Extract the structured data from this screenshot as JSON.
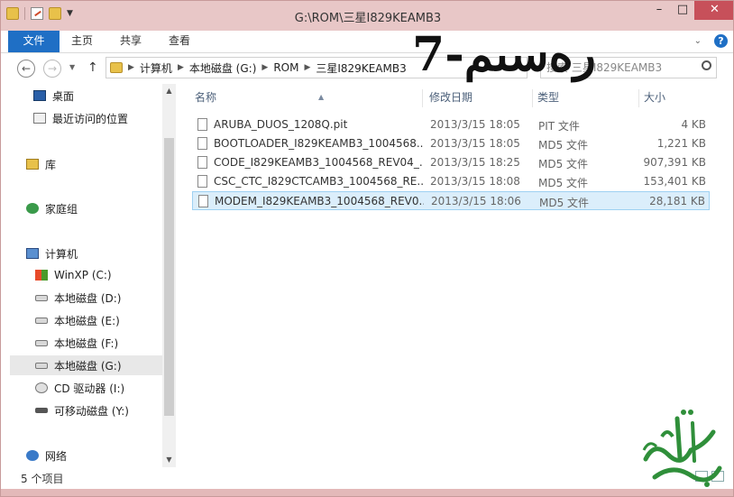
{
  "window": {
    "title": "G:\\ROM\\三星I829KEAMB3"
  },
  "winbtns": {
    "minimize": "–",
    "maximize": "□",
    "close": "✕"
  },
  "ribbon": {
    "tabs": [
      {
        "label": "文件"
      },
      {
        "label": "主页"
      },
      {
        "label": "共享"
      },
      {
        "label": "查看"
      }
    ],
    "help": "?"
  },
  "nav": {
    "back": "←",
    "forward": "→",
    "up": "↑",
    "breadcrumbs": [
      "计算机",
      "本地磁盘 (G:)",
      "ROM",
      "三星I829KEAMB3"
    ],
    "search_placeholder": "搜索 三星I829KEAMB3"
  },
  "overlay": {
    "text": "رەسىم-7"
  },
  "sidebar": {
    "items": [
      {
        "label": "桌面",
        "icon": "desktop-icon"
      },
      {
        "label": "最近访问的位置",
        "icon": "recent-places-icon"
      },
      {
        "label": "库",
        "icon": "library-icon"
      },
      {
        "label": "家庭组",
        "icon": "homegroup-icon"
      },
      {
        "label": "计算机",
        "icon": "computer-icon"
      },
      {
        "label": "WinXP (C:)",
        "icon": "winxp-drive-icon"
      },
      {
        "label": "本地磁盘 (D:)",
        "icon": "drive-icon"
      },
      {
        "label": "本地磁盘 (E:)",
        "icon": "drive-icon"
      },
      {
        "label": "本地磁盘 (F:)",
        "icon": "drive-icon"
      },
      {
        "label": "本地磁盘 (G:)",
        "icon": "drive-icon",
        "selected": true
      },
      {
        "label": "CD 驱动器 (I:)",
        "icon": "cd-drive-icon"
      },
      {
        "label": "可移动磁盘 (Y:)",
        "icon": "removable-drive-icon"
      },
      {
        "label": "网络",
        "icon": "network-icon"
      }
    ]
  },
  "filelist": {
    "columns": {
      "name": "名称",
      "date": "修改日期",
      "type": "类型",
      "size": "大小"
    },
    "files": [
      {
        "name": "ARUBA_DUOS_1208Q.pit",
        "date": "2013/3/15 18:05",
        "type": "PIT 文件",
        "size": "4 KB"
      },
      {
        "name": "BOOTLOADER_I829KEAMB3_1004568...",
        "date": "2013/3/15 18:05",
        "type": "MD5 文件",
        "size": "1,221 KB"
      },
      {
        "name": "CODE_I829KEAMB3_1004568_REV04_...",
        "date": "2013/3/15 18:25",
        "type": "MD5 文件",
        "size": "907,391 KB"
      },
      {
        "name": "CSC_CTC_I829CTCAMB3_1004568_RE...",
        "date": "2013/3/15 18:08",
        "type": "MD5 文件",
        "size": "153,401 KB"
      },
      {
        "name": "MODEM_I829KEAMB3_1004568_REV0...",
        "date": "2013/3/15 18:06",
        "type": "MD5 文件",
        "size": "28,181 KB",
        "selected": true
      }
    ]
  },
  "status": {
    "count": "5 个项目"
  },
  "colors": {
    "accent": "#1f6fc5",
    "title_bar": "#e8c7c7",
    "close": "#c7505a",
    "selection": "#dbeefb",
    "logo_green": "#2f8f3a"
  }
}
